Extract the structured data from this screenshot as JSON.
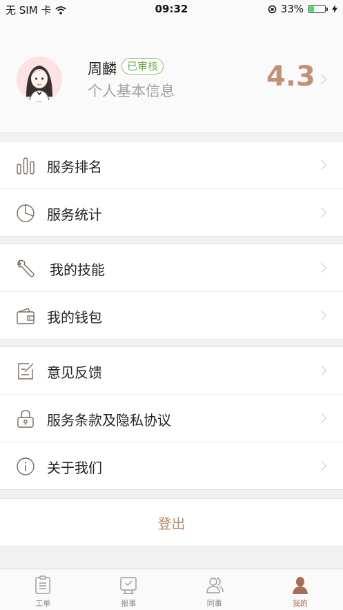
{
  "status_bar": {
    "carrier": "无 SIM 卡",
    "time": "09:32",
    "battery": "33%",
    "battery_level": 0.33
  },
  "profile": {
    "name": "周麟",
    "badge": "已审核",
    "subtitle": "个人基本信息",
    "rating": "4.3"
  },
  "menu_groups": [
    [
      {
        "label": "服务排名",
        "icon": "bar-chart-icon"
      },
      {
        "label": "服务统计",
        "icon": "pie-chart-icon"
      }
    ],
    [
      {
        "label": "我的技能",
        "icon": "wrench-icon"
      },
      {
        "label": "我的钱包",
        "icon": "wallet-icon"
      }
    ],
    [
      {
        "label": "意见反馈",
        "icon": "feedback-edit-icon"
      },
      {
        "label": "服务条款及隐私协议",
        "icon": "lock-icon"
      },
      {
        "label": "关于我们",
        "icon": "info-icon"
      }
    ]
  ],
  "logout_label": "登出",
  "tabs": [
    {
      "label": "工单",
      "icon": "clipboard-icon"
    },
    {
      "label": "报事",
      "icon": "report-icon"
    },
    {
      "label": "同事",
      "icon": "colleagues-icon"
    },
    {
      "label": "我的",
      "icon": "profile-icon",
      "active": true
    }
  ],
  "colors": {
    "accent": "#c29074",
    "verified": "#6aaa4c",
    "tab_active": "#a46f52"
  }
}
